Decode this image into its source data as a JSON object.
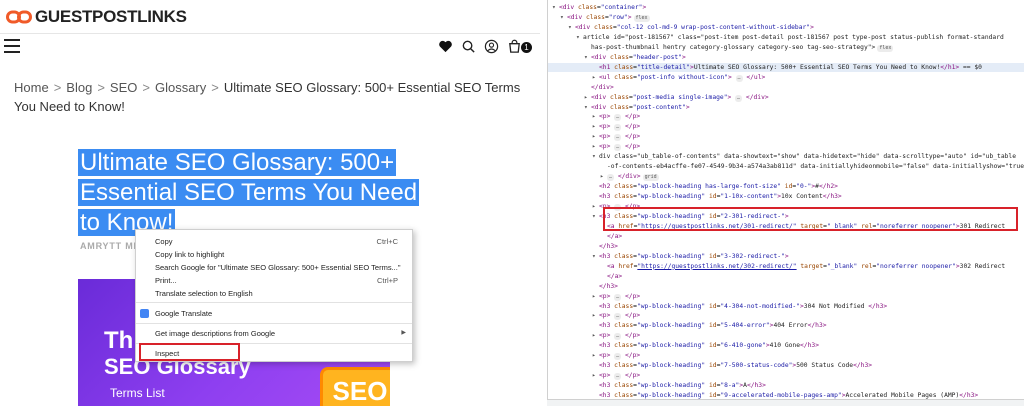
{
  "site": {
    "logo_text": "GUESTPOSTLINKS",
    "cart_count": "1",
    "breadcrumb": [
      "Home",
      "Blog",
      "SEO",
      "Glossary",
      "Ultimate SEO Glossary: 500+ Essential SEO Terms You Need to Know!"
    ],
    "post_title": "Ultimate SEO Glossary: 500+ Essential SEO Terms You Need to Know!",
    "author": "AMRYTT MED",
    "hero": {
      "line1": "Th",
      "line2": "SEO Glossary",
      "line3": "Terms List",
      "badge": "SEO"
    }
  },
  "context_menu": {
    "items": [
      {
        "label": "Copy",
        "shortcut": "Ctrl+C"
      },
      {
        "label": "Copy link to highlight",
        "shortcut": ""
      },
      {
        "label": "Search Google for \"Ultimate SEO Glossary: 500+ Essential SEO Terms...\"",
        "shortcut": ""
      },
      {
        "label": "Print...",
        "shortcut": "Ctrl+P"
      },
      {
        "label": "Translate selection to English",
        "shortcut": ""
      },
      {
        "label": "Google Translate",
        "shortcut": ""
      },
      {
        "label": "Get image descriptions from Google",
        "shortcut": ""
      },
      {
        "label": "Inspect",
        "shortcut": ""
      }
    ]
  },
  "devtools": {
    "lines": [
      {
        "open": "<div class=\"container\">",
        "ind": 0
      },
      {
        "open": "<div class=\"row\">",
        "pill": "flex",
        "ind": 1
      },
      {
        "open": "<div class=\"col-12 col-md-9 wrap-post-content-without-sidebar\">",
        "ind": 2
      },
      {
        "open": "<article id=\"post-181567\" class=\"post-item post-detail post-181567 post type-post status-publish format-standard",
        "ind": 3
      },
      {
        "open": "has-post-thumbnail hentry category-glossary category-seo tag-seo-strategy\">",
        "pill": "flex",
        "ind": 4
      },
      {
        "open": "<div class=\"header-post\">",
        "ind": 4
      },
      {
        "open": "<h1 class=\"title-detail\">Ultimate SEO Glossary: 500+ Essential SEO Terms You Need to Know!</h1> == $0",
        "ind": 5,
        "sel": true
      },
      {
        "open": "<ul class=\"post-info without-icon\"> … </ul>",
        "ind": 5
      },
      {
        "open": "</div>",
        "ind": 4
      },
      {
        "open": "<div class=\"post-media single-image\"> … </div>",
        "ind": 4
      },
      {
        "open": "<div class=\"post-content\">",
        "ind": 4
      },
      {
        "open": "<p> … </p>",
        "ind": 5
      },
      {
        "open": "<p> … </p>",
        "ind": 5
      },
      {
        "open": "<p> … </p>",
        "ind": 5
      },
      {
        "open": "<p> … </p>",
        "ind": 5
      },
      {
        "open": "<div class=\"ub_table-of-contents\" data-showtext=\"show\" data-hidetext=\"hide\" data-scrolltype=\"auto\" id=\"ub_table",
        "ind": 5
      },
      {
        "open": "-of-contents-eb4acffe-fe07-4549-9b34-a574a3ab811d\" data-initiallyhideonmobile=\"false\" data-initiallyshow=\"true\">",
        "ind": 6
      },
      {
        "open": "… </div>",
        "pill": "grid",
        "ind": 6
      },
      {
        "open": "<h2 class=\"wp-block-heading has-large-font-size\" id=\"0-\">#</h2>",
        "ind": 5
      },
      {
        "open": "<h3 class=\"wp-block-heading\" id=\"1-10x-content\">10x Content</h3>",
        "ind": 5
      },
      {
        "open": "<p> … </p>",
        "ind": 5
      },
      {
        "open": "<h3 class=\"wp-block-heading\" id=\"2-301-redirect-\">",
        "ind": 5
      },
      {
        "open": "<a href=\"https://guestpostlinks.net/301-redirect/\" target=\"_blank\" rel=\"noreferrer noopener\">301 Redirect",
        "ind": 6
      },
      {
        "open": "</a>",
        "ind": 6
      },
      {
        "open": "</h3>",
        "ind": 5
      },
      {
        "open": "<h3 class=\"wp-block-heading\" id=\"3-302-redirect-\">",
        "ind": 5
      },
      {
        "open": "<a href=\"https://guestpostlinks.net/302-redirect/\" target=\"_blank\" rel=\"noreferrer noopener\">302 Redirect",
        "ind": 6
      },
      {
        "open": "</a>",
        "ind": 6
      },
      {
        "open": "</h3>",
        "ind": 5
      },
      {
        "open": "<p> … </p>",
        "ind": 5
      },
      {
        "open": "<h3 class=\"wp-block-heading\" id=\"4-304-not-modified-\">304 Not Modified </h3>",
        "ind": 5
      },
      {
        "open": "<p> … </p>",
        "ind": 5
      },
      {
        "open": "<h3 class=\"wp-block-heading\" id=\"5-404-error\">404 Error</h3>",
        "ind": 5
      },
      {
        "open": "<p> … </p>",
        "ind": 5
      },
      {
        "open": "<h3 class=\"wp-block-heading\" id=\"6-410-gone\">410 Gone</h3>",
        "ind": 5
      },
      {
        "open": "<p> … </p>",
        "ind": 5
      },
      {
        "open": "<h3 class=\"wp-block-heading\" id=\"7-500-status-code\">500 Status Code</h3>",
        "ind": 5
      },
      {
        "open": "<p> … </p>",
        "ind": 5
      },
      {
        "open": "<h3 class=\"wp-block-heading\" id=\"8-a\">A</h3>",
        "ind": 5
      },
      {
        "open": "<h3 class=\"wp-block-heading\" id=\"9-accelerated-mobile-pages-amp\">Accelerated Mobile Pages (AMP)</h3>",
        "ind": 5
      }
    ]
  },
  "colors": {
    "highlight": "#3b8cf2",
    "annotation_red": "#d8222a",
    "hero_purple": "#7b34e4"
  }
}
